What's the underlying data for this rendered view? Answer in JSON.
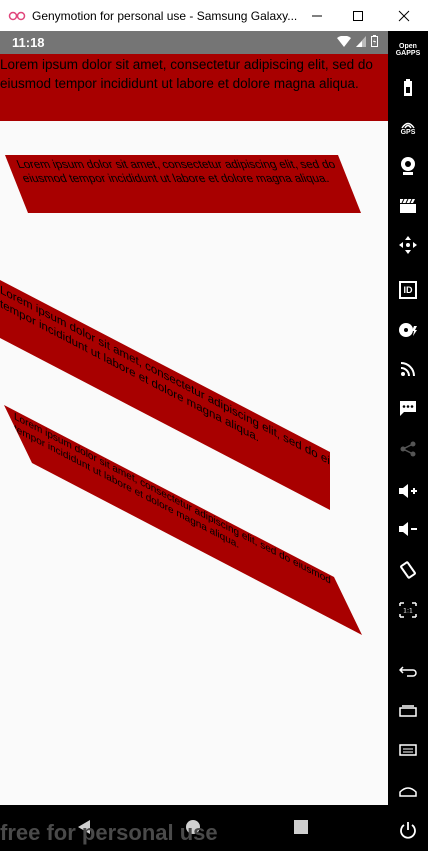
{
  "window": {
    "title": "Genymotion for personal use - Samsung Galaxy...",
    "controls": [
      "minimize-icon",
      "maximize-icon",
      "close-icon"
    ]
  },
  "status_bar": {
    "time": "11:18",
    "icons": [
      "wifi-icon",
      "signal-icon",
      "battery-icon"
    ]
  },
  "content": {
    "lorem": "Lorem ipsum dolor sit amet, consectetur adipiscing elit, sed do eiusmod tempor incididunt ut labore et dolore magna aliqua.",
    "accent_color": "#a80000"
  },
  "nav_bar": {
    "watermark": "free for personal use",
    "buttons": [
      "back-icon",
      "home-icon",
      "recents-icon"
    ]
  },
  "sidebar": {
    "opengapps": "Open GAPPS",
    "gps": "GPS",
    "id": "ID",
    "items": [
      "battery-icon",
      "gps-icon",
      "camera-icon",
      "video-icon",
      "dpad-icon",
      "id-icon",
      "disk-icon",
      "cast-icon",
      "sms-icon",
      "share-icon",
      "volume-up-icon",
      "volume-down-icon",
      "rotate-icon",
      "scale-icon",
      "back-icon",
      "recent-apps-icon",
      "menu-icon",
      "home-icon",
      "power-icon"
    ]
  }
}
